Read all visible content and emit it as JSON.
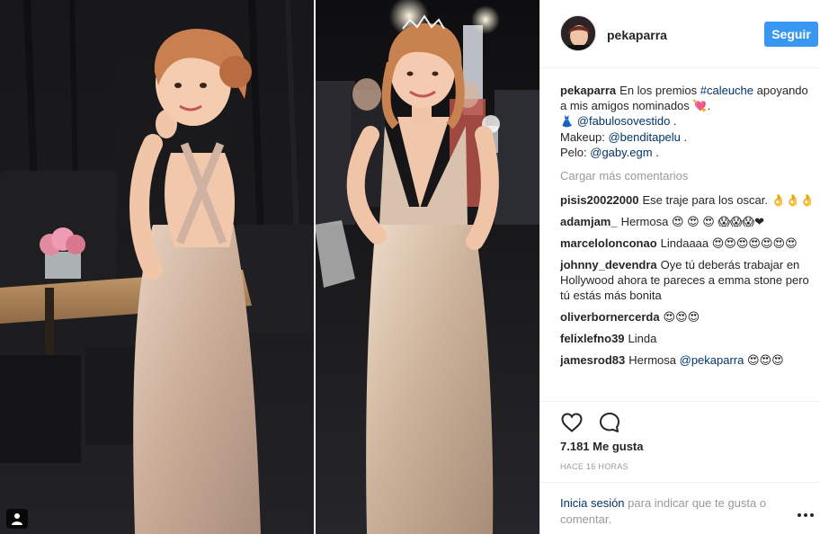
{
  "post": {
    "username": "pekaparra",
    "follow_label": "Seguir",
    "caption": {
      "username": "pekaparra",
      "text_before": "En los premios ",
      "hashtag": "#caleuche",
      "text_after": " apoyando a mis amigos nominados 💘.",
      "line2_prefix": "👗 ",
      "mention_dress": "@fabulosovestido",
      "line2_suffix": " .",
      "makeup_label": "Makeup: ",
      "mention_makeup": "@benditapelu",
      "makeup_suffix": " .",
      "hair_label": "Pelo: ",
      "mention_hair": "@gaby.egm",
      "hair_suffix": " ."
    },
    "load_more": "Cargar más comentarios",
    "comments": [
      {
        "username": "pisis20022000",
        "text": "Ese traje para los oscar. 👌👌👌"
      },
      {
        "username": "adamjam_",
        "text": "Hermosa 😍 😍 😍 😱😱😱❤"
      },
      {
        "username": "marcelolonconao",
        "text": "Lindaaaa 😍😍😍😍😍😍😍"
      },
      {
        "username": "johnny_devendra",
        "text": "Oye tú deberás trabajar en Hollywood ahora te pareces a emma stone pero tú estás más bonita"
      },
      {
        "username": "oliverbornercerda",
        "text": "😍😍😍"
      },
      {
        "username": "felixlefno39",
        "text": "Linda"
      },
      {
        "username": "jamesrod83",
        "text": "Hermosa ",
        "mention": "@pekaparra",
        "suffix": " 😍😍😍"
      }
    ],
    "likes": "7.181 Me gusta",
    "timestamp": "HACE 16 HORAS",
    "login": {
      "link": "Inicia sesión",
      "text": " para indicar que te gusta o comentar."
    }
  },
  "icons": {
    "like": "heart-icon",
    "comment": "comment-icon",
    "more": "more-options-icon",
    "tag": "user-tag-icon"
  },
  "colors": {
    "follow_button": "#3897f0",
    "link": "#003569",
    "muted": "#999999",
    "text": "#262626"
  }
}
